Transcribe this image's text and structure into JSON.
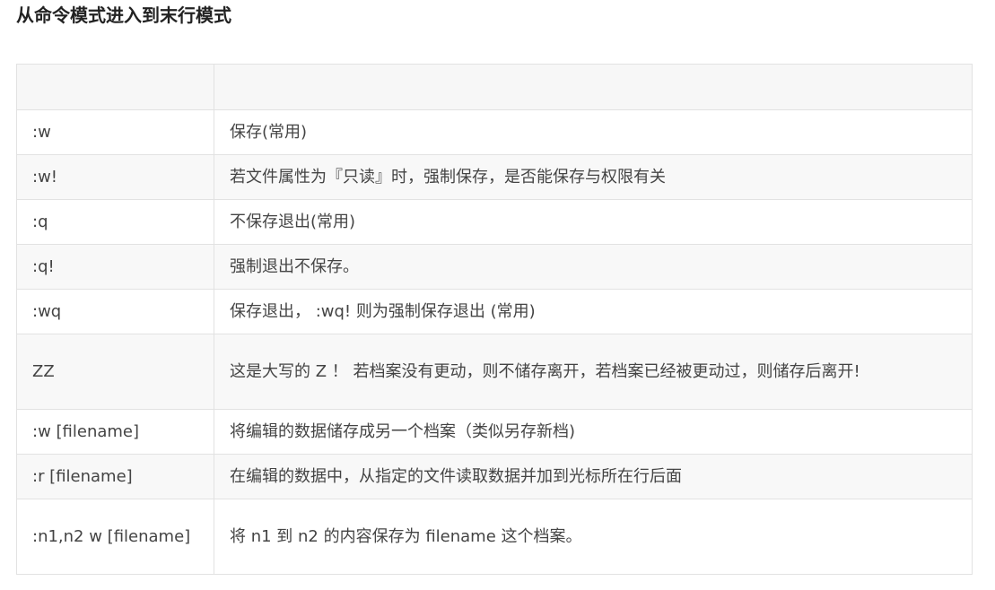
{
  "title": "从命令模式进入到末行模式",
  "table": {
    "headers": [
      "",
      ""
    ],
    "rows": [
      {
        "command": ":w",
        "description": "保存(常用)"
      },
      {
        "command": ":w!",
        "description": "若文件属性为『只读』时，强制保存，是否能保存与权限有关"
      },
      {
        "command": ":q",
        "description": "不保存退出(常用)"
      },
      {
        "command": ":q!",
        "description": "强制退出不保存。"
      },
      {
        "command": ":wq",
        "description": "保存退出， :wq! 则为强制保存退出 (常用)"
      },
      {
        "command": "ZZ",
        "description": "这是大写的 Z ！ 若档案没有更动，则不储存离开，若档案已经被更动过，则储存后离开!"
      },
      {
        "command": ":w [filename]",
        "description": "将编辑的数据储存成另一个档案（类似另存新档)"
      },
      {
        "command": ":r [filename]",
        "description": "在编辑的数据中，从指定的文件读取数据并加到光标所在行后面"
      },
      {
        "command": ":n1,n2 w [filename]",
        "description": "将 n1 到 n2 的内容保存为 filename 这个档案。"
      }
    ]
  }
}
